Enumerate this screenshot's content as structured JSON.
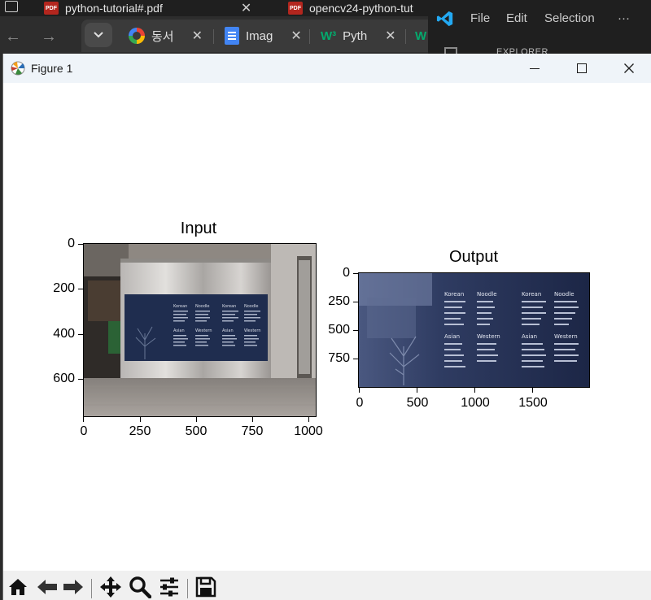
{
  "browser": {
    "tabs_top": [
      {
        "label": "python-tutorial#.pdf"
      },
      {
        "label": "opencv24-python-tut"
      }
    ],
    "tabs": [
      {
        "label": "동서"
      },
      {
        "label": "Imag"
      },
      {
        "label": "Pyth"
      }
    ]
  },
  "vscode": {
    "menu": [
      "File",
      "Edit",
      "Selection",
      "···"
    ],
    "explorer_label": "EXPLORER"
  },
  "figure": {
    "window_title": "Figure 1",
    "axes": [
      {
        "title": "Input",
        "x_ticks": [
          "0",
          "250",
          "500",
          "750",
          "1000"
        ],
        "y_ticks": [
          "0",
          "200",
          "400",
          "600"
        ]
      },
      {
        "title": "Output",
        "x_ticks": [
          "0",
          "500",
          "1000",
          "1500"
        ],
        "y_ticks": [
          "0",
          "250",
          "500",
          "750"
        ]
      }
    ],
    "menu_board": {
      "col1_head": "Korean",
      "col2_head": "Noodle",
      "col3_head": "Asian",
      "col4_head": "Western"
    }
  },
  "toolbar": {
    "buttons": [
      "home",
      "back",
      "forward",
      "pan",
      "zoom",
      "configure",
      "save"
    ]
  }
}
